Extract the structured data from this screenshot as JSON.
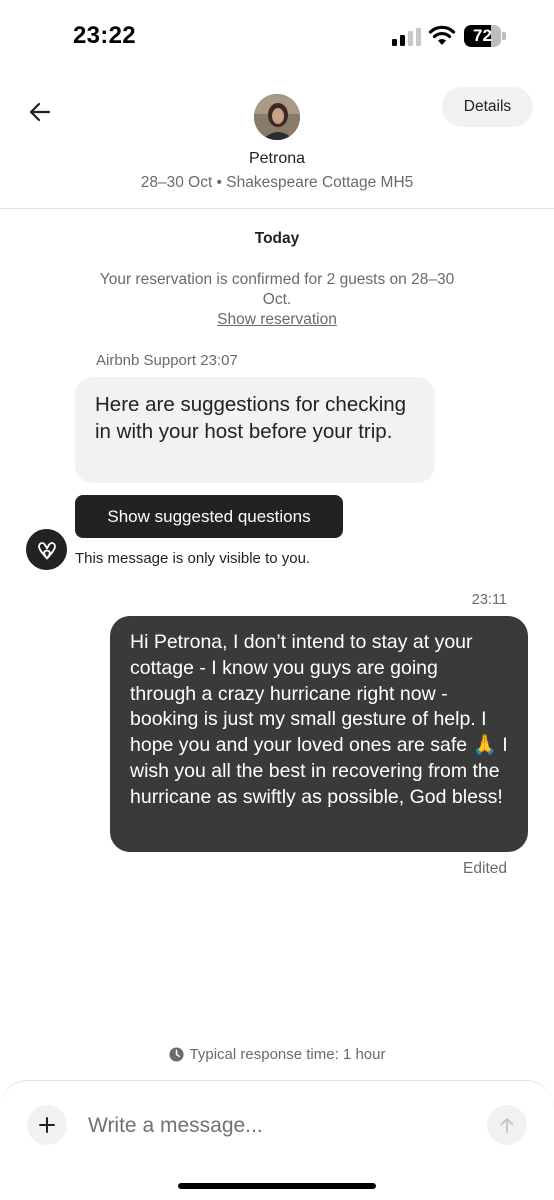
{
  "status_bar": {
    "time": "23:22",
    "battery_level": "72",
    "battery_fraction": 0.72,
    "icons": [
      "cellular-signal-icon",
      "wifi-icon",
      "battery-icon"
    ]
  },
  "header": {
    "back_icon": "arrow-left-icon",
    "host_name": "Petrona",
    "trip_info": "28–30 Oct • Shakespeare Cottage MH5",
    "details_label": "Details"
  },
  "chat": {
    "date_label": "Today",
    "reservation_text": "Your reservation is confirmed for 2 guests on 28–30 Oct.",
    "show_reservation_label": "Show reservation",
    "support_sender": "Airbnb Support 23:07",
    "support_message": "Here are suggestions for checking in with your host before your trip.",
    "suggested_questions_label": "Show suggested questions",
    "visibility_note": "This message is only visible to you.",
    "sent_time": "23:11",
    "sent_message": "Hi Petrona, I don’t intend to stay at your cottage - I know you guys are going through a crazy hurricane right now - booking is just my small gesture of help. I hope you and your loved ones are safe 🙏 I wish you all the best in recovering from the hurricane as swiftly as possible, God bless!",
    "edited_label": "Edited",
    "response_time": "Typical response time: 1 hour"
  },
  "composer": {
    "placeholder": "Write a message...",
    "add_icon": "plus-icon",
    "send_icon": "arrow-up-icon"
  },
  "colors": {
    "sent_bubble": "#3a3a3a",
    "received_bubble": "#f2f2f2",
    "dark_button": "#222222",
    "muted_text": "#6a6a6a"
  }
}
